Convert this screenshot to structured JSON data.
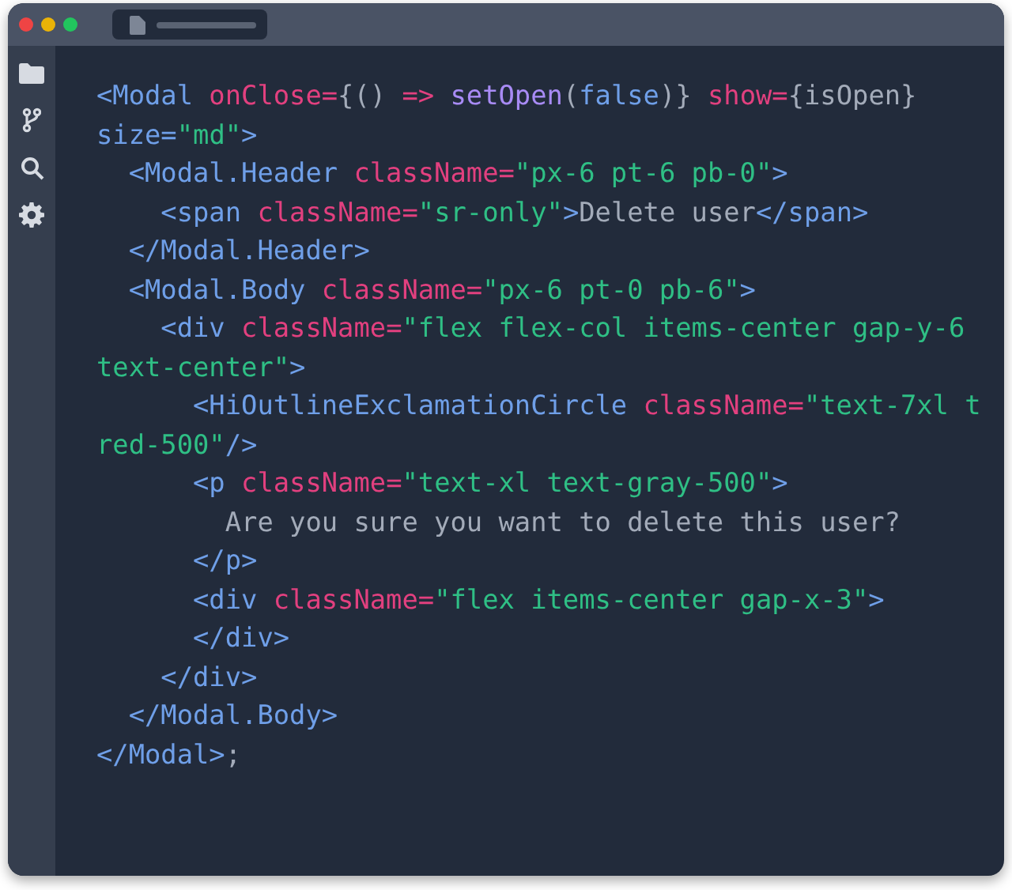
{
  "window": {
    "tab": {
      "selected": true
    }
  },
  "sidebar": {
    "items": [
      {
        "kind": "folder",
        "selected": false
      },
      {
        "kind": "branch",
        "selected": false
      },
      {
        "kind": "search",
        "selected": false
      },
      {
        "kind": "settings",
        "selected": false
      }
    ]
  },
  "code": {
    "lines": [
      [
        {
          "kind": "tag",
          "text": "<Modal"
        },
        {
          "kind": "attr",
          "text": " onClose"
        },
        {
          "kind": "attr",
          "text": "="
        },
        {
          "kind": "plain",
          "text": "{() "
        },
        {
          "kind": "attr",
          "text": "=>"
        },
        {
          "kind": "fn",
          "text": " setOpen"
        },
        {
          "kind": "plain",
          "text": "("
        },
        {
          "kind": "tag",
          "text": "false"
        },
        {
          "kind": "plain",
          "text": ")} "
        },
        {
          "kind": "attr",
          "text": "show"
        },
        {
          "kind": "attr",
          "text": "="
        },
        {
          "kind": "plain",
          "text": "{isOpen}"
        }
      ],
      [
        {
          "kind": "tag",
          "text": "size="
        },
        {
          "kind": "str",
          "text": "\"md\""
        },
        {
          "kind": "tag",
          "text": ">"
        }
      ],
      [
        {
          "kind": "tag",
          "text": "  <Modal.Header"
        },
        {
          "kind": "attr",
          "text": " className"
        },
        {
          "kind": "attr",
          "text": "="
        },
        {
          "kind": "str",
          "text": "\"px-6 pt-6 pb-0\""
        },
        {
          "kind": "tag",
          "text": ">"
        }
      ],
      [
        {
          "kind": "tag",
          "text": "    <span"
        },
        {
          "kind": "attr",
          "text": " className"
        },
        {
          "kind": "attr",
          "text": "="
        },
        {
          "kind": "str",
          "text": "\"sr-only\""
        },
        {
          "kind": "tag",
          "text": ">"
        },
        {
          "kind": "plain",
          "text": "Delete user"
        },
        {
          "kind": "tag",
          "text": "</span>"
        }
      ],
      [
        {
          "kind": "tag",
          "text": "  </Modal.Header>"
        }
      ],
      [
        {
          "kind": "tag",
          "text": "  <Modal.Body"
        },
        {
          "kind": "attr",
          "text": " className"
        },
        {
          "kind": "attr",
          "text": "="
        },
        {
          "kind": "str",
          "text": "\"px-6 pt-0 pb-6\""
        },
        {
          "kind": "tag",
          "text": ">"
        }
      ],
      [
        {
          "kind": "tag",
          "text": "    <div"
        },
        {
          "kind": "attr",
          "text": " className"
        },
        {
          "kind": "attr",
          "text": "="
        },
        {
          "kind": "str",
          "text": "\"flex flex-col items-center gap-y-6"
        }
      ],
      [
        {
          "kind": "str",
          "text": "text-center\""
        },
        {
          "kind": "tag",
          "text": ">"
        }
      ],
      [
        {
          "kind": "tag",
          "text": "      <HiOutlineExclamationCircle"
        },
        {
          "kind": "attr",
          "text": " className"
        },
        {
          "kind": "attr",
          "text": "="
        },
        {
          "kind": "str",
          "text": "\"text-7xl t"
        }
      ],
      [
        {
          "kind": "str",
          "text": "red-500\""
        },
        {
          "kind": "tag",
          "text": "/>"
        }
      ],
      [
        {
          "kind": "tag",
          "text": "      <p"
        },
        {
          "kind": "attr",
          "text": " className"
        },
        {
          "kind": "attr",
          "text": "="
        },
        {
          "kind": "str",
          "text": "\"text-xl text-gray-500\""
        },
        {
          "kind": "tag",
          "text": ">"
        }
      ],
      [
        {
          "kind": "plain",
          "text": "        Are you sure you want to delete this user?"
        }
      ],
      [
        {
          "kind": "tag",
          "text": "      </p>"
        }
      ],
      [
        {
          "kind": "tag",
          "text": "      <div"
        },
        {
          "kind": "attr",
          "text": " className"
        },
        {
          "kind": "attr",
          "text": "="
        },
        {
          "kind": "str",
          "text": "\"flex items-center gap-x-3\""
        },
        {
          "kind": "tag",
          "text": ">"
        }
      ],
      [
        {
          "kind": "tag",
          "text": "      </div>"
        }
      ],
      [
        {
          "kind": "tag",
          "text": "    </div>"
        }
      ],
      [
        {
          "kind": "tag",
          "text": "  </Modal.Body>"
        }
      ],
      [
        {
          "kind": "tag",
          "text": "</Modal>"
        },
        {
          "kind": "plain",
          "text": ";"
        }
      ]
    ]
  }
}
